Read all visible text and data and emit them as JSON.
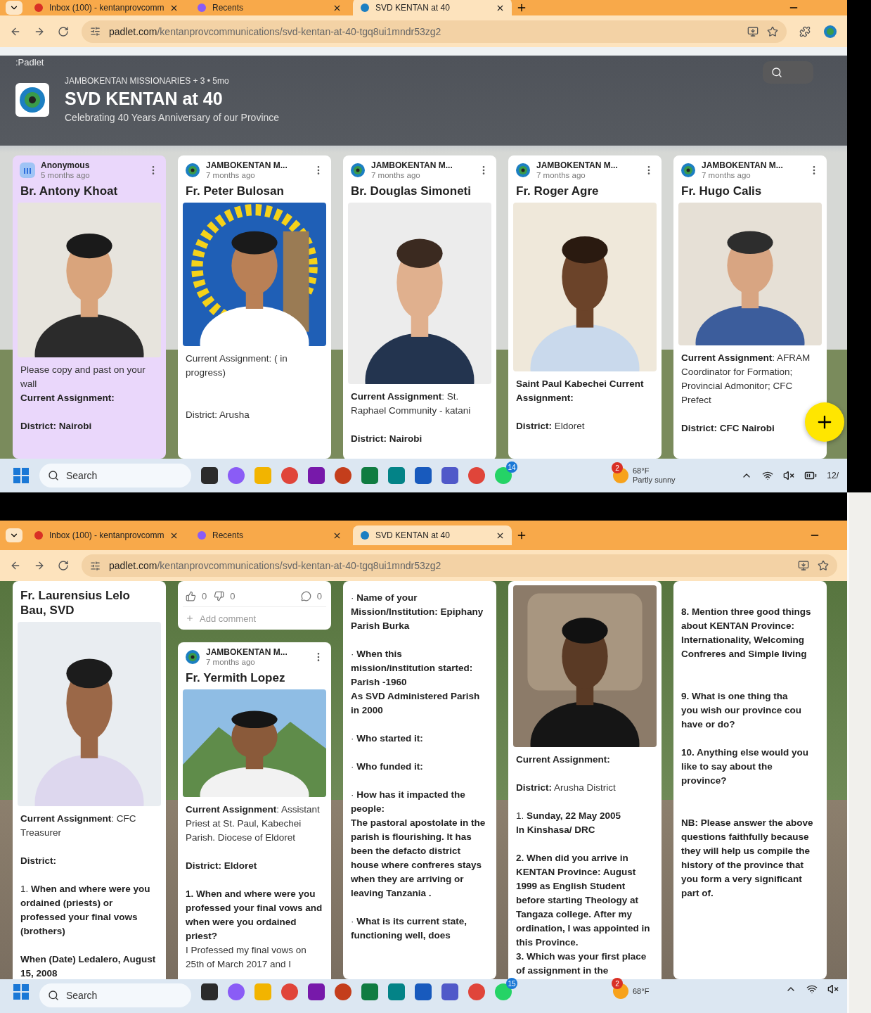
{
  "screens": [
    {
      "tabs": [
        {
          "label": "Inbox (100) - kentanprovcomm",
          "selected": false
        },
        {
          "label": "Recents",
          "selected": false
        },
        {
          "label": "SVD KENTAN at 40",
          "selected": true
        }
      ],
      "address": {
        "host": "padlet.com",
        "path": "/kentanprovcommunications/svd-kentan-at-40-tgq8ui1mndr53zg2"
      },
      "board": {
        "brand": ":Padlet",
        "meta": "JAMBOKENTAN MISSIONARIES + 3 • 5mo",
        "title": "SVD KENTAN at 40",
        "subtitle": "Celebrating 40 Years Anniversary of our Province"
      },
      "columns": [
        {
          "cards": [
            {
              "tinted": true,
              "blocks": [
                {
                  "kind": "anonymous-header",
                  "author": "Anonymous",
                  "time": "5 months ago"
                },
                {
                  "kind": "title",
                  "text": "Br. Antony Khoat"
                },
                {
                  "kind": "picture"
                },
                {
                  "kind": "text",
                  "text": "Please copy and past on your wall\n**Current Assignment:**\n\n**District: Nairobi**"
                }
              ]
            }
          ]
        },
        {
          "cards": [
            {
              "tinted": false,
              "blocks": [
                {
                  "kind": "header",
                  "author": "JAMBOKENTAN M...",
                  "time": "7 months ago"
                },
                {
                  "kind": "title",
                  "text": "Fr. Peter  Bulosan"
                },
                {
                  "kind": "picture"
                },
                {
                  "kind": "text",
                  "text": "Current Assignment: ( in progress)\n\n\n\nDistrict: Arusha"
                }
              ]
            }
          ]
        },
        {
          "cards": [
            {
              "tinted": false,
              "blocks": [
                {
                  "kind": "header",
                  "author": "JAMBOKENTAN M...",
                  "time": "7 months ago"
                },
                {
                  "kind": "title",
                  "text": "Br. Douglas Simoneti"
                },
                {
                  "kind": "picture"
                },
                {
                  "kind": "text",
                  "text": "**Current Assignment**: St. Raphael Community - katani\n\n**District: Nairobi**"
                }
              ]
            }
          ]
        },
        {
          "cards": [
            {
              "tinted": false,
              "blocks": [
                {
                  "kind": "header",
                  "author": "JAMBOKENTAN M...",
                  "time": "7 months ago"
                },
                {
                  "kind": "title",
                  "text": "Fr. Roger Agre"
                },
                {
                  "kind": "picture"
                },
                {
                  "kind": "text",
                  "text": "**Saint Paul Kabechei Current Assignment:**\n\n**District:** Eldoret"
                }
              ]
            }
          ]
        },
        {
          "cards": [
            {
              "tinted": false,
              "blocks": [
                {
                  "kind": "header",
                  "author": "JAMBOKENTAN M...",
                  "time": "7 months ago"
                },
                {
                  "kind": "title",
                  "text": "Fr. Hugo Calis"
                },
                {
                  "kind": "picture"
                },
                {
                  "kind": "text",
                  "text": "**Current Assignment**: AFRAM Coordinator for Formation; Provincial Admonitor; CFC Prefect\n\n**District: CFC Nairobi**"
                }
              ]
            }
          ]
        }
      ],
      "taskbar": {
        "search": "Search",
        "chat_badge": "14",
        "weather": {
          "badge": "2",
          "temp": "68°F",
          "condition": "Partly sunny"
        },
        "clock": "12/"
      }
    },
    {
      "tabs": [
        {
          "label": "Inbox (100) - kentanprovcomm",
          "selected": false
        },
        {
          "label": "Recents",
          "selected": false
        },
        {
          "label": "SVD KENTAN at 40",
          "selected": true
        }
      ],
      "address": {
        "host": "padlet.com",
        "path": "/kentanprovcommunications/svd-kentan-at-40-tgq8ui1mndr53zg2"
      },
      "columns": [
        {
          "cards": [
            {
              "tinted": false,
              "blocks": [
                {
                  "kind": "title",
                  "text": "Fr. Laurensius Lelo Bau, SVD"
                },
                {
                  "kind": "picture"
                },
                {
                  "kind": "text",
                  "text": "**Current Assignment**: CFC Treasurer\n\n**District:**\n\n1.     **When and where were you ordained (priests) or professed your final vows (brothers)**\n\n**When (Date) Ledalero, August 15, 2008**"
                }
              ]
            }
          ]
        },
        {
          "cards": [
            {
              "tinted": false,
              "blocks": [
                {
                  "kind": "reactions",
                  "likes": "0",
                  "dislikes": "0",
                  "comments": "0"
                },
                {
                  "kind": "comment",
                  "placeholder": "Add comment"
                }
              ]
            },
            {
              "tinted": false,
              "blocks": [
                {
                  "kind": "header",
                  "author": "JAMBOKENTAN M...",
                  "time": "7 months ago"
                },
                {
                  "kind": "title",
                  "text": "Fr. Yermith Lopez"
                },
                {
                  "kind": "picture"
                },
                {
                  "kind": "text",
                  "text": "**Current Assignment**: Assistant Priest at St. Paul, Kabechei Parish. Diocese of Eldoret\n\n**District: Eldoret**\n\n**1.     When and where were you professed your final vows and when were you ordained priest?**\nI Professed my final vows on 25th of March 2017 and I"
                }
              ]
            }
          ]
        },
        {
          "cards": [
            {
              "tinted": false,
              "blocks": [
                {
                  "kind": "text",
                  "text": "·     **Name of your Mission/Institution: Epiphany Parish Burka**\n\n·     **When this mission/institution started: Parish -1960\nAs SVD Administered Parish in 2000**\n\n·     **Who started it:**\n\n·     **Who funded it:**\n\n·     **How has it impacted the people:\nThe pastoral apostolate in the parish is flourishing. It has been the defacto district house where confreres stays when they are arriving or leaving Tanzania .**\n\n·     **What is its current state, functioning well, does**"
                }
              ]
            }
          ]
        },
        {
          "cards": [
            {
              "tinted": false,
              "blocks": [
                {
                  "kind": "picture"
                },
                {
                  "kind": "text",
                  "text": "**Current Assignment:**\n\n**District:**  Arusha District\n\n1.     **Sunday, 22 May 2005\nIn Kinshasa/ DRC**\n\n**2. When did you arrive in KENTAN Province: August 1999 as English Student before starting Theology at Tangaza college. After my ordination, I was appointed in this Province.\n3.     Which was your first place of assignment in the**"
                }
              ]
            }
          ]
        },
        {
          "cards": [
            {
              "tinted": false,
              "blocks": [
                {
                  "kind": "text",
                  "text": "\n\n**8.     Mention three good things about KENTAN Province: Internationality, Welcoming Confreres and Simple living**\n\n\n\n**9.     What is one thing tha\nyou wish our province cou\nhave or do?**\n\n**10. Anything else would you\nlike to say about the\nprovince?**\n\n\n\n**NB: Please answer the above questions faithfully because they will help us compile the history of the province that you form a very significant part of.**"
                }
              ]
            }
          ]
        }
      ],
      "taskbar": {
        "search": "Search",
        "chat_badge": "15",
        "weather": {
          "badge": "2",
          "temp": "68°F"
        }
      }
    }
  ]
}
